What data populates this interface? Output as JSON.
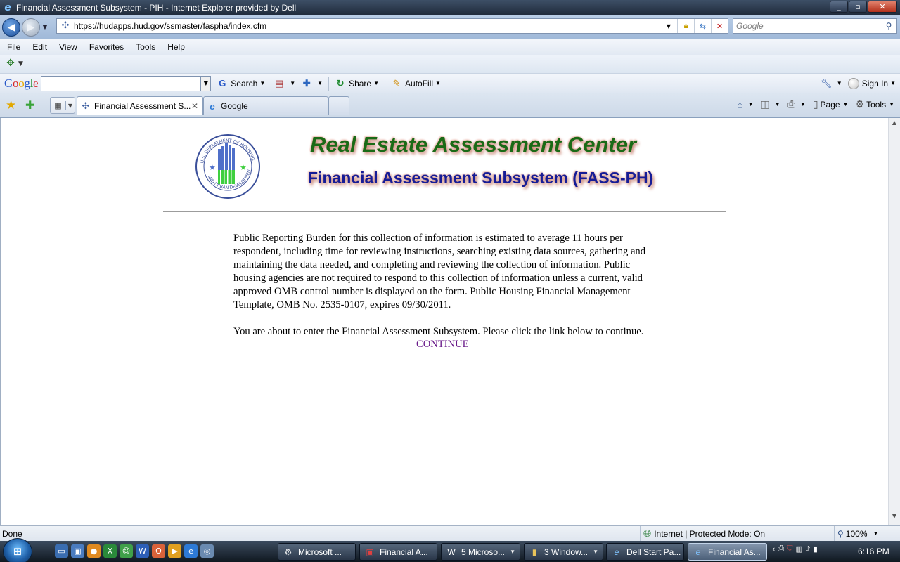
{
  "window": {
    "title": "Financial Assessment Subsystem - PIH - Internet Explorer provided by Dell"
  },
  "address": {
    "url": "https://hudapps.hud.gov/ssmaster/faspha/index.cfm",
    "search_placeholder": "Google"
  },
  "menu": [
    "File",
    "Edit",
    "View",
    "Favorites",
    "Tools",
    "Help"
  ],
  "google_toolbar": {
    "logo": "Google",
    "search_label": "Search",
    "share_label": "Share",
    "autofill_label": "AutoFill",
    "signin_label": "Sign In"
  },
  "tabs": [
    {
      "label": "Financial Assessment S...",
      "active": true
    },
    {
      "label": "Google",
      "active": false
    }
  ],
  "command_bar": {
    "page_label": "Page",
    "tools_label": "Tools"
  },
  "content": {
    "heading1": "Real Estate Assessment Center",
    "heading2": "Financial Assessment Subsystem (FASS-PH)",
    "seal_text": "U.S. DEPARTMENT OF HOUSING AND URBAN DEVELOPMENT",
    "burden_text": "Public Reporting Burden for this collection of information is estimated to average 11 hours per respondent, including time for reviewing instructions, searching existing data sources, gathering and maintaining the data needed, and completing and reviewing the collection of information. Public housing agencies are not required to respond to this collection of information unless a current, valid approved OMB control number is displayed on the form. Public Housing Financial Management Template, OMB No. 2535-0107, expires 09/30/2011.",
    "enter_text": "You are about to enter the Financial Assessment Subsystem. Please click the link below to continue.",
    "continue_link": "CONTINUE"
  },
  "status": {
    "left": "Done",
    "zone": "Internet | Protected Mode: On",
    "zoom": "100%"
  },
  "taskbar": {
    "items": [
      {
        "label": "Microsoft ..."
      },
      {
        "label": "Financial A..."
      },
      {
        "label": "5 Microso..."
      },
      {
        "label": "3 Window..."
      },
      {
        "label": "Dell Start Pa..."
      },
      {
        "label": "Financial As..."
      }
    ],
    "clock": "6:16 PM"
  },
  "colors": {
    "heading1": "#1a6a16",
    "heading2": "#161c96",
    "link_visited": "#6a1b8a"
  }
}
